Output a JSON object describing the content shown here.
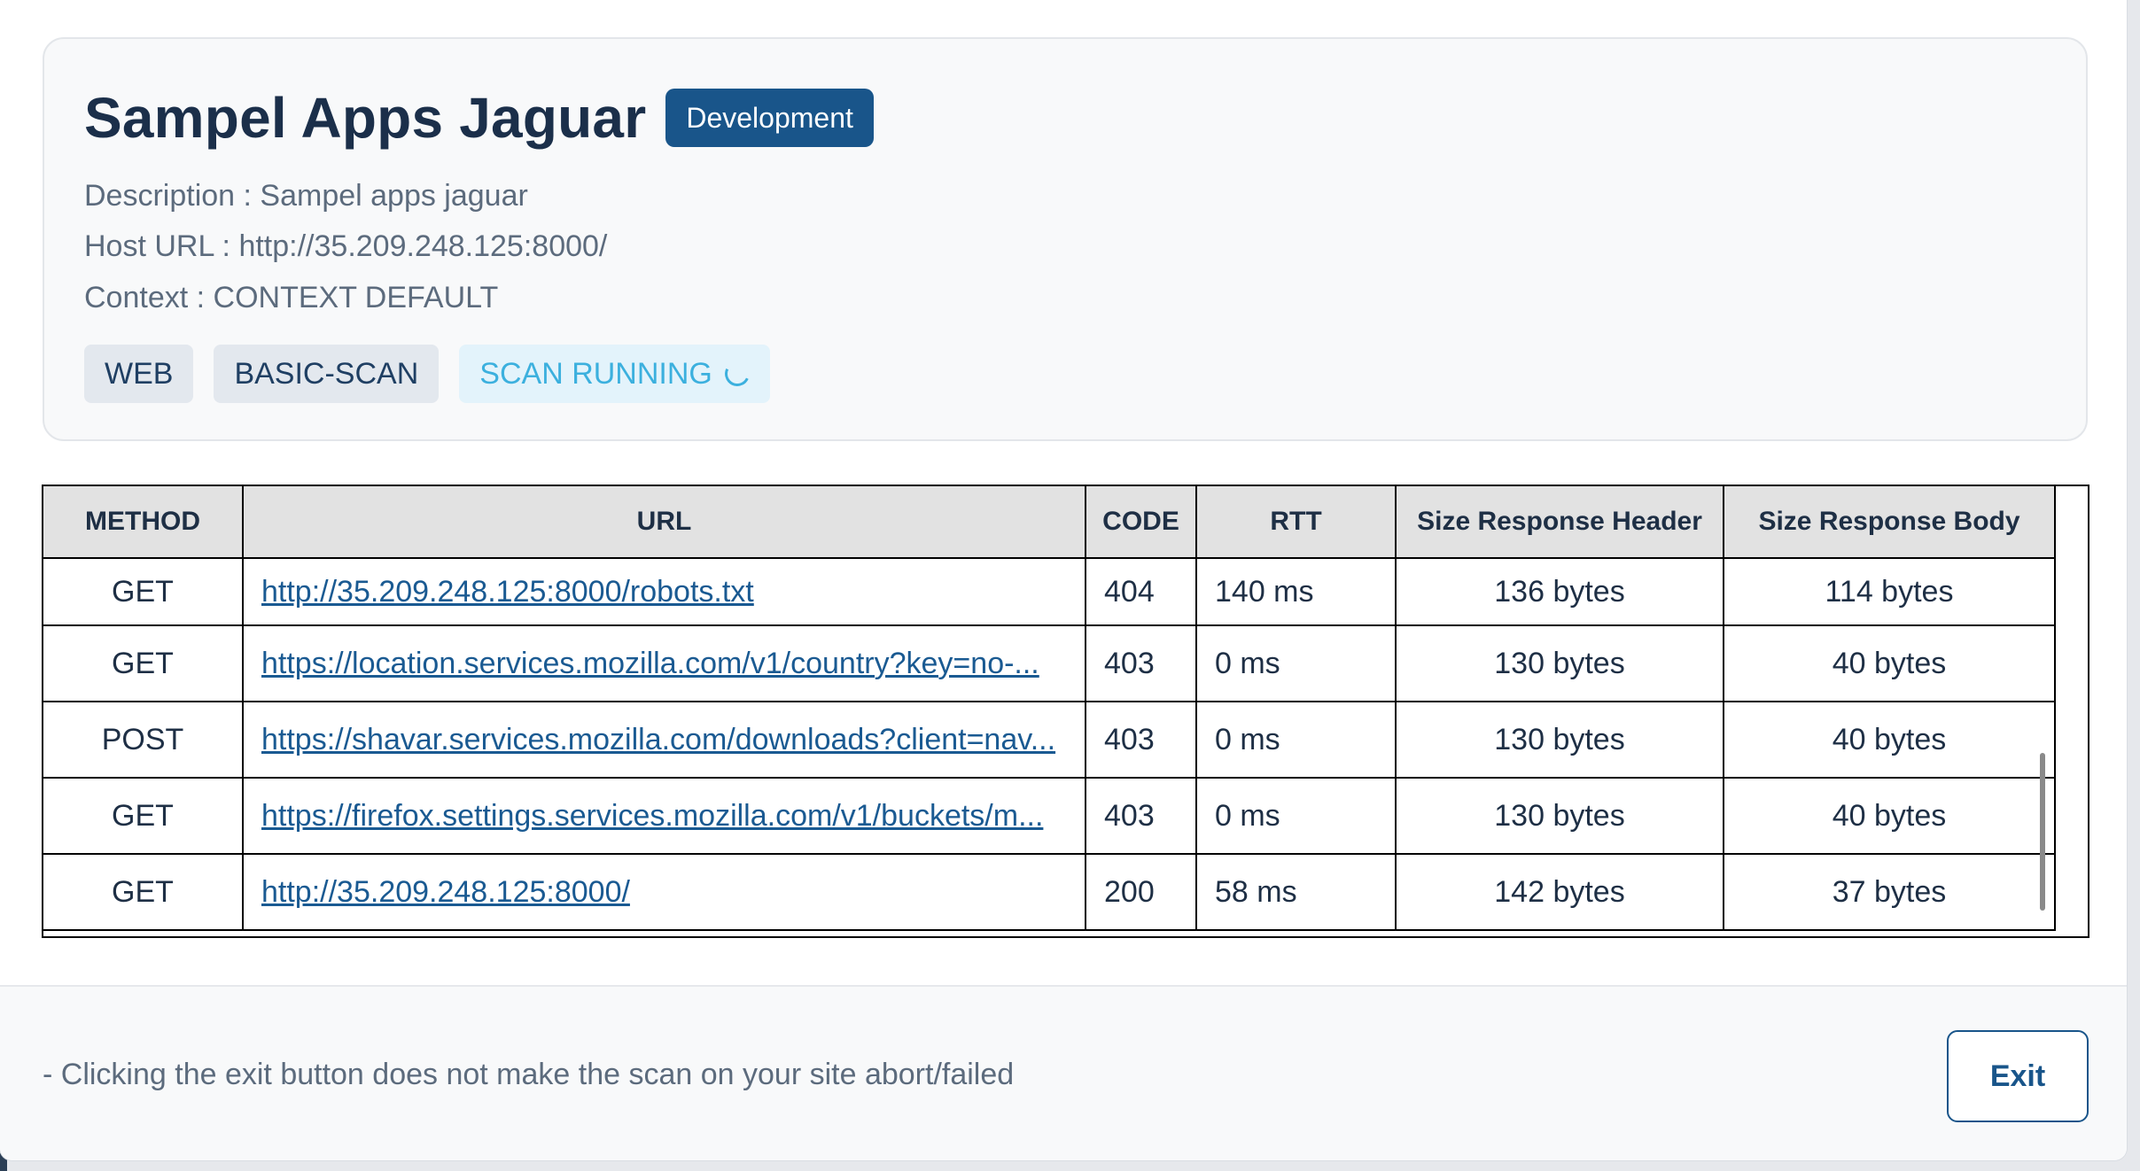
{
  "app": {
    "title": "Sampel Apps Jaguar",
    "environment": "Development",
    "description": "Description : Sampel apps jaguar",
    "host_url": "Host URL : http://35.209.248.125:8000/",
    "context": "Context : CONTEXT DEFAULT",
    "tags": [
      "WEB",
      "BASIC-SCAN",
      "SCAN RUNNING"
    ]
  },
  "table": {
    "headers": [
      "METHOD",
      "URL",
      "CODE",
      "RTT",
      "Size Response Header",
      "Size Response Body"
    ],
    "rows": [
      {
        "method": "GET",
        "url": "http://35.209.248.125:8000/robots.txt",
        "code": "404",
        "rtt": "140 ms",
        "header_size": "136 bytes",
        "body_size": "114 bytes"
      },
      {
        "method": "GET",
        "url": "https://location.services.mozilla.com/v1/country?key=no-...",
        "code": "403",
        "rtt": "0 ms",
        "header_size": "130 bytes",
        "body_size": "40 bytes"
      },
      {
        "method": "POST",
        "url": "https://shavar.services.mozilla.com/downloads?client=nav...",
        "code": "403",
        "rtt": "0 ms",
        "header_size": "130 bytes",
        "body_size": "40 bytes"
      },
      {
        "method": "GET",
        "url": "https://firefox.settings.services.mozilla.com/v1/buckets/m...",
        "code": "403",
        "rtt": "0 ms",
        "header_size": "130 bytes",
        "body_size": "40 bytes"
      },
      {
        "method": "GET",
        "url": "http://35.209.248.125:8000/",
        "code": "200",
        "rtt": "58 ms",
        "header_size": "142 bytes",
        "body_size": "37 bytes"
      }
    ]
  },
  "footer": {
    "note": "- Clicking the exit button does not make the scan on your site abort/failed",
    "exit_label": "Exit"
  },
  "colors": {
    "primary": "#19558a",
    "title": "#1b2f4a",
    "muted_text": "#5c6b7d",
    "running": "#3cb0de",
    "link": "#1a5a92"
  }
}
